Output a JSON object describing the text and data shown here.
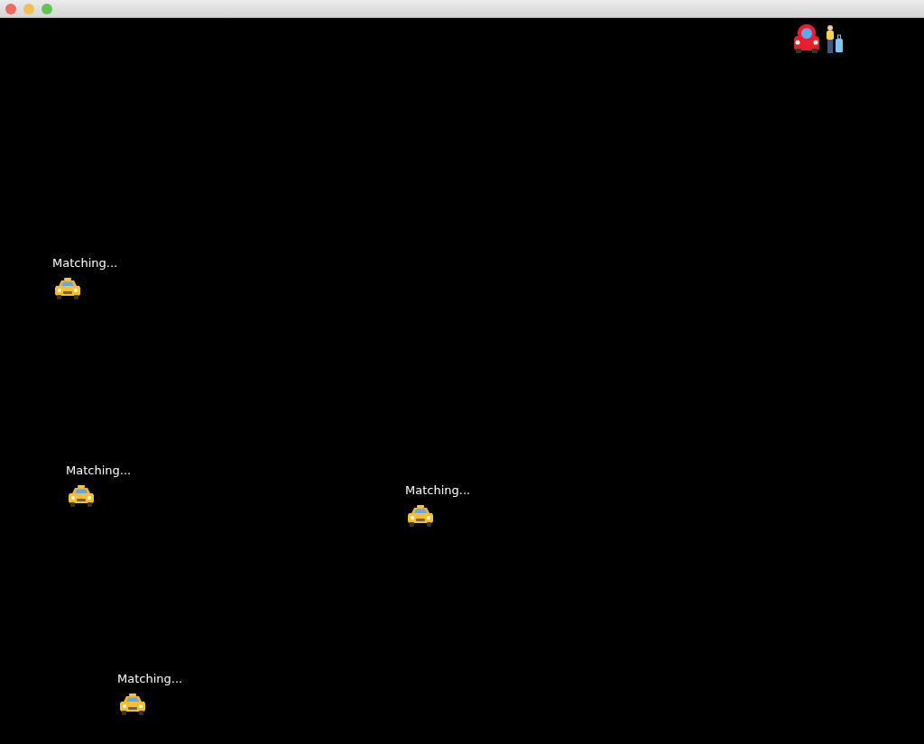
{
  "agents": [
    {
      "kind": "car_with_passenger"
    },
    {
      "kind": "taxi",
      "status": "Matching..."
    },
    {
      "kind": "taxi",
      "status": "Matching..."
    },
    {
      "kind": "taxi",
      "status": "Matching..."
    },
    {
      "kind": "taxi",
      "status": "Matching..."
    }
  ]
}
